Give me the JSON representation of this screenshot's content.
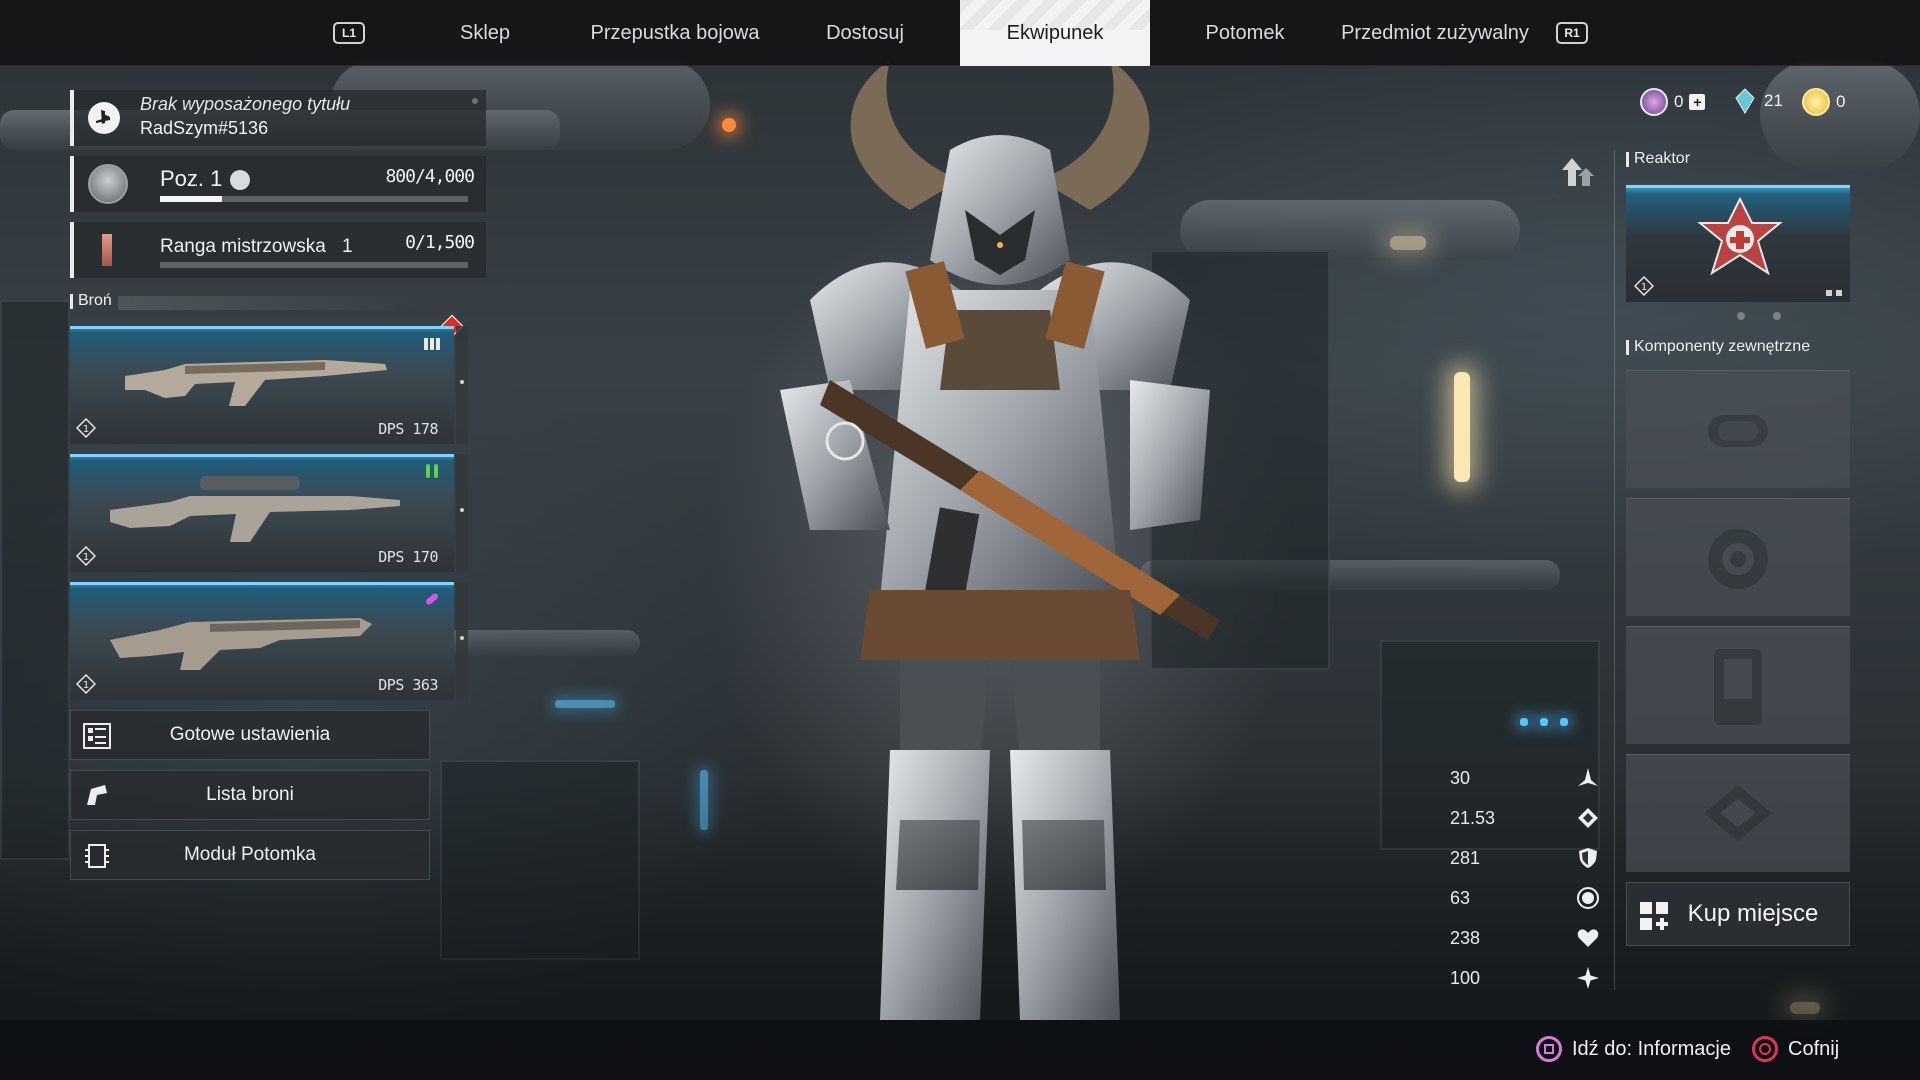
{
  "nav": {
    "left_shoulder": "L1",
    "right_shoulder": "R1",
    "tabs": [
      {
        "label": "Sklep"
      },
      {
        "label": "Przepustka bojowa"
      },
      {
        "label": "Dostosuj"
      },
      {
        "label": "Ekwipunek",
        "active": true
      },
      {
        "label": "Potomek"
      },
      {
        "label": "Przedmiot zużywalny"
      }
    ]
  },
  "player": {
    "title": "Brak wyposażonego tytułu",
    "name": "RadSzym#5136",
    "level_label": "Poz. 1",
    "xp": "800/4,000",
    "xp_progress": 0.2,
    "mastery_label": "Ranga mistrzowska",
    "mastery_rank": "1",
    "mastery_xp": "0/1,500",
    "mastery_progress": 0
  },
  "weapons_section": "Broń",
  "weapons": [
    {
      "dps_label": "DPS",
      "dps": "178",
      "tier": "1",
      "ammo": "general-ammo-icon",
      "ammo_color": "#e8e8e8"
    },
    {
      "dps_label": "DPS",
      "dps": "170",
      "tier": "1",
      "ammo": "special-ammo-icon",
      "ammo_color": "#5cd14a"
    },
    {
      "dps_label": "DPS",
      "dps": "363",
      "tier": "1",
      "ammo": "high-power-ammo-icon",
      "ammo_color": "#d257e6"
    }
  ],
  "menu": {
    "presets": "Gotowe ustawienia",
    "weapon_list": "Lista broni",
    "module": "Moduł Potomka"
  },
  "currency": [
    {
      "icon": "caliber-icon",
      "value": "0"
    },
    {
      "icon": "crystal-icon",
      "value": "21"
    },
    {
      "icon": "gold-icon",
      "value": "0"
    }
  ],
  "reactor": {
    "label": "Reaktor",
    "tier": "1"
  },
  "components": {
    "label": "Komponenty zewnętrzne"
  },
  "buy_slot": "Kup miejsce",
  "stats": [
    {
      "value": "30",
      "icon": "attack-icon"
    },
    {
      "value": "21.53",
      "icon": "defense-icon"
    },
    {
      "value": "281",
      "icon": "shield-icon"
    },
    {
      "value": "63",
      "icon": "mp-icon"
    },
    {
      "value": "238",
      "icon": "hp-icon"
    },
    {
      "value": "100",
      "icon": "resistance-icon"
    }
  ],
  "hints": {
    "info": "Idź do: Informacje",
    "back": "Cofnij"
  },
  "colors": {
    "accent_blue": "#3fa7d6",
    "square_button": "#d77bd8",
    "circle_button": "#e0355a",
    "alert": "#e02828"
  }
}
